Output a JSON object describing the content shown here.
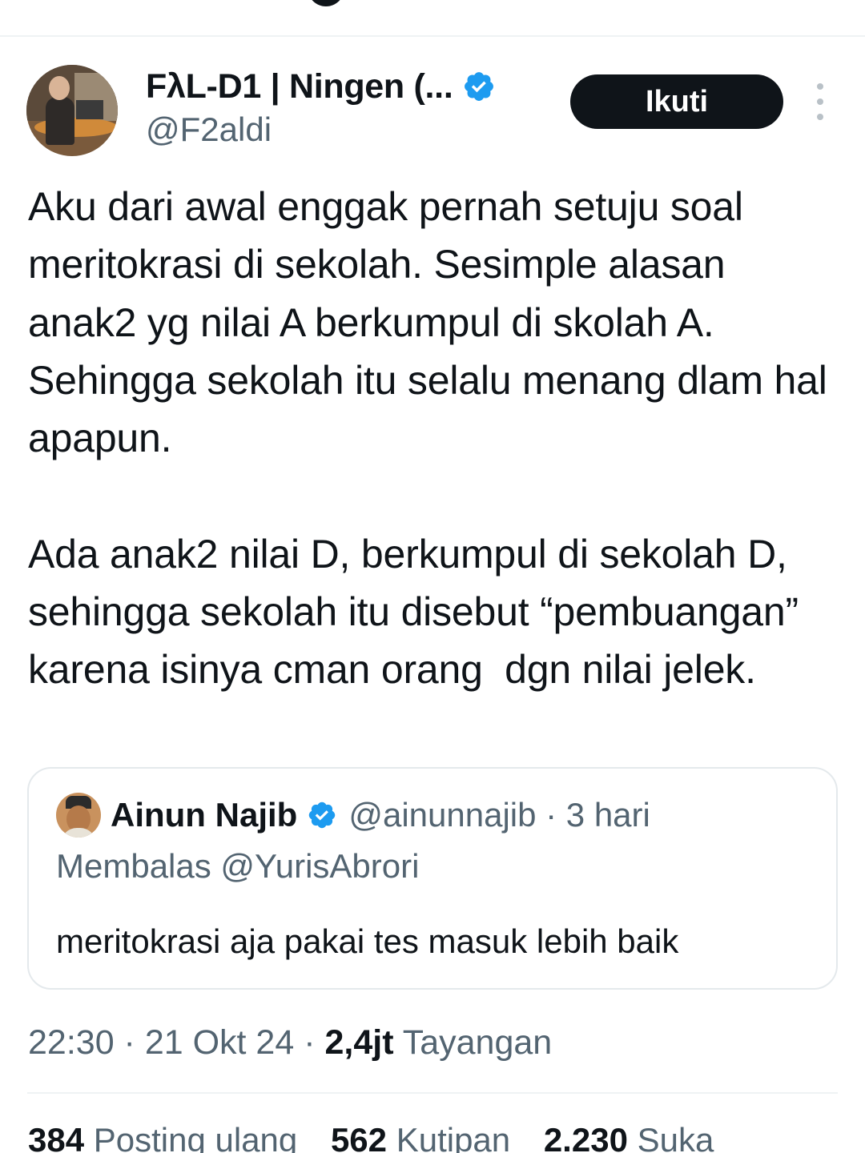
{
  "tweet": {
    "author": {
      "display_name": "FλL-D1 | Ningen (...",
      "handle": "@F2aldi",
      "verified": true,
      "avatar_icon": "profile-photo"
    },
    "follow_label": "Ikuti",
    "more_icon": "vertical-ellipsis-icon",
    "text": "Aku dari awal enggak pernah setuju soal meritokrasi di sekolah. Sesimple alasan anak2 yg nilai A berkumpul di skolah A. Sehingga sekolah itu selalu menang dlam hal apapun.\n\nAda anak2 nilai D, berkumpul di sekolah D, sehingga sekolah itu disebut “pembuangan” karena isinya cman orang  dgn nilai jelek.",
    "quote": {
      "name": "Ainun Najib",
      "verified": true,
      "handle_time": "@ainunnajib · 3 hari",
      "reply_to": "Membalas @YurisAbrori",
      "text": "meritokrasi aja pakai tes masuk lebih baik"
    },
    "meta": {
      "time_date": "22:30 · 21 Okt 24 · ",
      "views_count": "2,4jt",
      "views_label": "Tayangan"
    },
    "stats": {
      "reposts_count": "384",
      "reposts_label": "Posting ulang",
      "quotes_count": "562",
      "quotes_label": "Kutipan",
      "likes_count": "2.230",
      "likes_label": "Suka"
    },
    "colors": {
      "text": "#0f1419",
      "secondary": "#536471",
      "verified_blue": "#1d9bf0",
      "button_bg": "#0f1419"
    }
  }
}
